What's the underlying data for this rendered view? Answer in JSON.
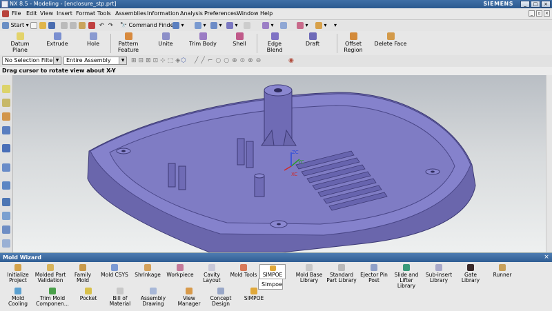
{
  "window": {
    "title": "NX 8.5 - Modeling - [enclosure_stp.prt]",
    "brand": "SIEMENS",
    "controls": [
      "_",
      "□",
      "×"
    ]
  },
  "menu": {
    "items": [
      "File",
      "Edit",
      "View",
      "Insert",
      "Format",
      "Tools",
      "Assemblies",
      "Information",
      "Analysis",
      "Preferences",
      "Window",
      "Help"
    ]
  },
  "toolbar": {
    "start": "Start",
    "command_finder": "Command Finder"
  },
  "feature_toolbar": {
    "buttons": [
      "Datum Plane",
      "Extrude",
      "Hole",
      "Pattern Feature",
      "Unite",
      "Trim Body",
      "Shell",
      "Edge Blend",
      "Draft",
      "Offset Region",
      "Delete Face"
    ]
  },
  "selection_bar": {
    "filter": "No Selection Filter",
    "scope": "Entire Assembly"
  },
  "status": {
    "cue": "Drag cursor to rotate view about X-Y"
  },
  "csys": {
    "x": "XC",
    "y": "YC",
    "z": "ZC"
  },
  "mold_wizard": {
    "title": "Mold Wizard",
    "row1": [
      "Initialize Project",
      "Molded Part Validation",
      "Family Mold",
      "Mold CSYS",
      "Shrinkage",
      "Workpiece",
      "Cavity Layout",
      "Mold Tools",
      "SIMPOE",
      "Mold Base Library",
      "Standard Part Library",
      "Ejector Pin Post",
      "Slide and Lifter Library",
      "Sub-insert Library",
      "Gate Library",
      "Runner"
    ],
    "row2": [
      "Mold Cooling",
      "Trim Mold Componen...",
      "Pocket",
      "Bill of Material",
      "Assembly Drawing",
      "View Manager",
      "Concept Design",
      "SIMPOE"
    ],
    "popup_item": "Simpoe"
  },
  "colors": {
    "part": "#6f6ab0",
    "title_bar": "#3a6aa3"
  }
}
